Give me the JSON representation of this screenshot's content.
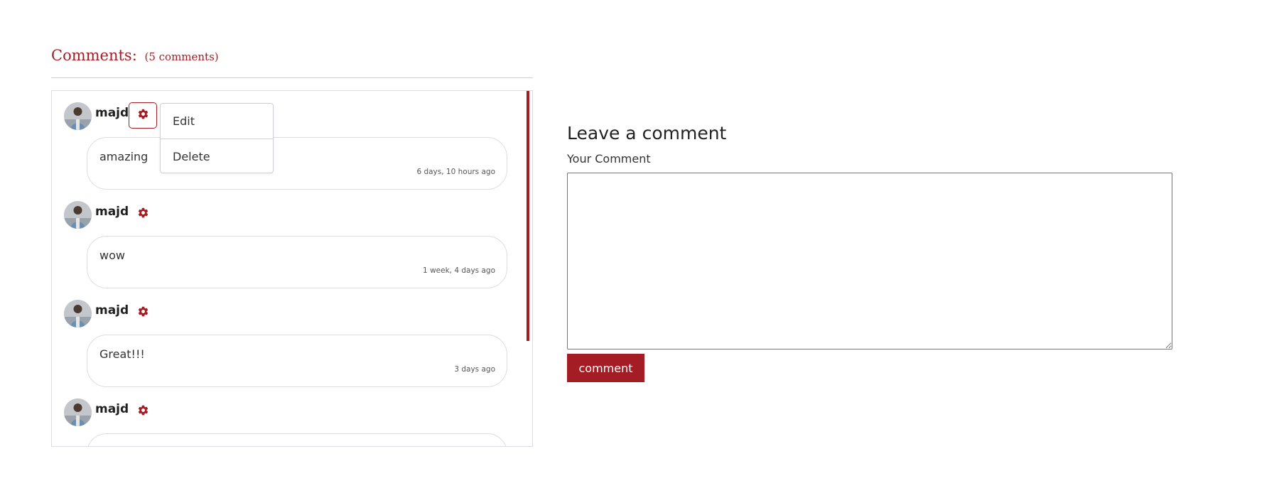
{
  "comments_section": {
    "title": "Comments:",
    "count_label": "(5 comments)"
  },
  "comments": [
    {
      "author": "majd",
      "text": "amazing",
      "time": "6 days, 10 hours ago"
    },
    {
      "author": "majd",
      "text": "wow",
      "time": "1 week, 4 days ago"
    },
    {
      "author": "majd",
      "text": "Great!!!",
      "time": "3 days ago"
    },
    {
      "author": "majd",
      "text": "",
      "time": ""
    }
  ],
  "dropdown": {
    "items": [
      {
        "label": "Edit"
      },
      {
        "label": "Delete"
      }
    ]
  },
  "form": {
    "title": "Leave a comment",
    "label": "Your Comment",
    "textarea_value": "",
    "submit_label": "comment"
  },
  "colors": {
    "accent": "#a51d24",
    "border": "#dcdce4"
  },
  "icons": {
    "settings": "gear-icon",
    "avatar": "user-avatar"
  }
}
